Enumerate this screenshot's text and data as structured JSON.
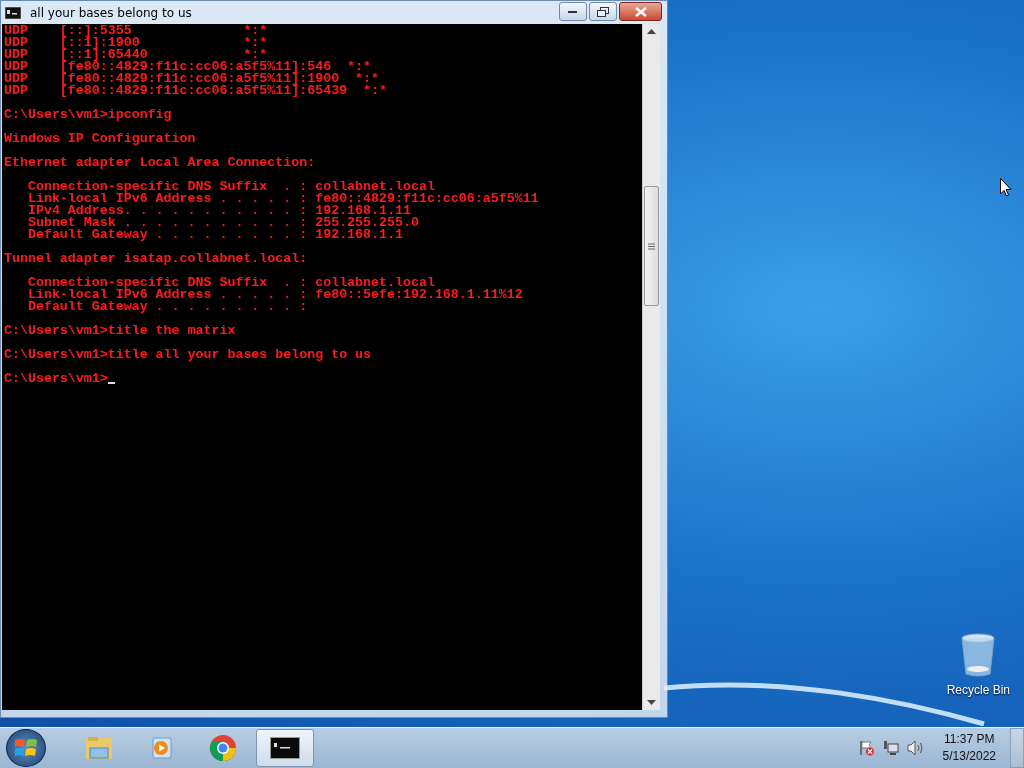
{
  "window": {
    "title": "all your bases belong to us"
  },
  "console": {
    "blocks": [
      [
        "UDP    [::]:5355              *:*",
        "UDP    [::1]:1900             *:*",
        "UDP    [::1]:65440            *:*",
        "UDP    [fe80::4829:f11c:cc06:a5f5%11]:546  *:*",
        "UDP    [fe80::4829:f11c:cc06:a5f5%11]:1900  *:*",
        "UDP    [fe80::4829:f11c:cc06:a5f5%11]:65439  *:*"
      ],
      [
        "C:\\Users\\vm1>ipconfig"
      ],
      [
        "Windows IP Configuration"
      ],
      [
        "Ethernet adapter Local Area Connection:"
      ],
      [
        "   Connection-specific DNS Suffix  . : collabnet.local",
        "   Link-local IPv6 Address . . . . . : fe80::4829:f11c:cc06:a5f5%11",
        "   IPv4 Address. . . . . . . . . . . : 192.168.1.11",
        "   Subnet Mask . . . . . . . . . . . : 255.255.255.0",
        "   Default Gateway . . . . . . . . . : 192.168.1.1"
      ],
      [
        "Tunnel adapter isatap.collabnet.local:"
      ],
      [
        "   Connection-specific DNS Suffix  . : collabnet.local",
        "   Link-local IPv6 Address . . . . . : fe80::5efe:192.168.1.11%12",
        "   Default Gateway . . . . . . . . . :"
      ],
      [
        "C:\\Users\\vm1>title the matrix"
      ],
      [
        "C:\\Users\\vm1>title all your bases belong to us"
      ]
    ],
    "prompt": "C:\\Users\\vm1>"
  },
  "desktop": {
    "icons": [
      {
        "label": "Recycle Bin"
      }
    ]
  },
  "taskbar": {
    "apps": [
      {
        "kind": "explorer",
        "selected": false
      },
      {
        "kind": "media",
        "selected": false
      },
      {
        "kind": "chrome",
        "selected": false
      },
      {
        "kind": "cmd",
        "selected": true
      }
    ],
    "clock": {
      "time": "11:37 PM",
      "date": "5/13/2022"
    }
  }
}
